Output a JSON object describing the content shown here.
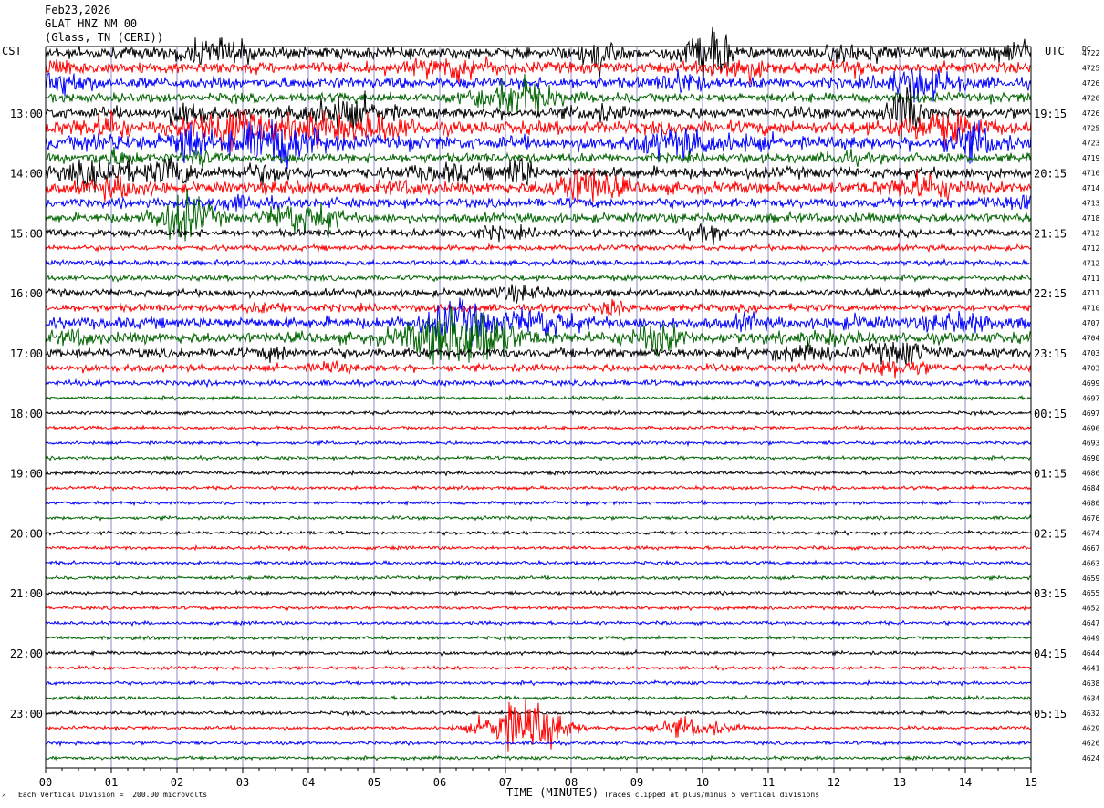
{
  "header": {
    "date": "Feb23,2026",
    "station": "GLAT HNZ NM 00",
    "location": "(Glass, TN (CERI))"
  },
  "left_zone_label": "CST",
  "right_zone_label": "UTC",
  "dc_label": "DC",
  "footer": {
    "left_note": "Each Vertical Division =  200.00 microvolts",
    "right_note": "Traces clipped at plus/minus 5 vertical divisions",
    "corner_mark": "^"
  },
  "colors": {
    "trace_cycle": [
      "#000000",
      "#ff0000",
      "#0000ff",
      "#006400"
    ],
    "grid": "#8c8cc8",
    "axis": "#000000"
  },
  "chart_data": {
    "type": "line",
    "title": "",
    "xlabel": "TIME (MINUTES)",
    "x_ticks": [
      "00",
      "01",
      "02",
      "03",
      "04",
      "05",
      "06",
      "07",
      "08",
      "09",
      "10",
      "11",
      "12",
      "13",
      "14",
      "15"
    ],
    "xlim": [
      0,
      15
    ],
    "left_hour_labels": [
      "13:00",
      "14:00",
      "15:00",
      "16:00",
      "17:00",
      "18:00",
      "19:00",
      "20:00",
      "21:00",
      "22:00",
      "23:00"
    ],
    "right_hour_labels": [
      "19:15",
      "20:15",
      "21:15",
      "22:15",
      "23:15",
      "00:15",
      "01:15",
      "02:15",
      "03:15",
      "04:15",
      "05:15"
    ],
    "hour_label_first_trace": 4,
    "traces_per_hour": 4,
    "dc_offsets": [
      4722,
      4725,
      4726,
      4726,
      4726,
      4725,
      4723,
      4719,
      4716,
      4714,
      4713,
      4718,
      4712,
      4712,
      4712,
      4711,
      4711,
      4710,
      4707,
      4704,
      4703,
      4703,
      4699,
      4697,
      4697,
      4696,
      4693,
      4690,
      4686,
      4684,
      4680,
      4676,
      4674,
      4667,
      4663,
      4659,
      4655,
      4652,
      4647,
      4649,
      4644,
      4641,
      4638,
      4634,
      4632,
      4629,
      4626,
      4624
    ],
    "trace_activity": [
      5,
      5,
      5,
      4,
      5,
      6,
      6,
      4,
      5,
      5,
      4,
      4,
      3,
      2,
      2,
      2,
      3,
      3,
      5,
      5,
      4,
      3,
      2,
      1,
      1,
      1,
      1,
      1,
      1,
      1,
      1,
      1,
      1,
      1,
      1,
      1,
      1,
      1,
      1,
      1,
      1,
      1,
      1,
      1,
      1,
      1,
      1,
      1
    ],
    "events": [
      {
        "trace": 0,
        "minute": 10.2,
        "amplitude": 5,
        "duration": 0.4
      },
      {
        "trace": 0,
        "minute": 8.4,
        "amplitude": 3,
        "duration": 0.5
      },
      {
        "trace": 4,
        "minute": 13.1,
        "amplitude": 5,
        "duration": 0.4
      },
      {
        "trace": 5,
        "minute": 2.8,
        "amplitude": 4,
        "duration": 1.0
      },
      {
        "trace": 6,
        "minute": 3.5,
        "amplitude": 4,
        "duration": 1.2
      },
      {
        "trace": 6,
        "minute": 2.1,
        "amplitude": 3,
        "duration": 0.6
      },
      {
        "trace": 9,
        "minute": 8.2,
        "amplitude": 3,
        "duration": 1.0
      },
      {
        "trace": 8,
        "minute": 7.2,
        "amplitude": 3,
        "duration": 0.4
      },
      {
        "trace": 11,
        "minute": 2.1,
        "amplitude": 4,
        "duration": 0.8
      },
      {
        "trace": 19,
        "minute": 6.3,
        "amplitude": 5,
        "duration": 1.5
      },
      {
        "trace": 18,
        "minute": 6.3,
        "amplitude": 3,
        "duration": 1.0
      },
      {
        "trace": 45,
        "minute": 7.3,
        "amplitude": 5,
        "duration": 1.2
      },
      {
        "trace": 45,
        "minute": 9.8,
        "amplitude": 1.5,
        "duration": 1.2
      }
    ]
  }
}
